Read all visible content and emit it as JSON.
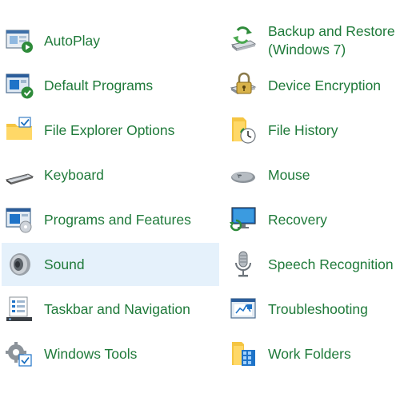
{
  "control_panel": {
    "left_column": [
      {
        "label": "AutoPlay",
        "icon": "autoplay-icon"
      },
      {
        "label": "Default Programs",
        "icon": "default-programs-icon"
      },
      {
        "label": "File Explorer Options",
        "icon": "folder-options-icon"
      },
      {
        "label": "Keyboard",
        "icon": "keyboard-icon"
      },
      {
        "label": "Programs and Features",
        "icon": "programs-features-icon"
      },
      {
        "label": "Sound",
        "icon": "speaker-icon",
        "selected": true
      },
      {
        "label": "Taskbar and Navigation",
        "icon": "taskbar-icon"
      },
      {
        "label": "Windows Tools",
        "icon": "windows-tools-icon"
      }
    ],
    "right_column": [
      {
        "label": "Backup and Restore (Windows 7)",
        "icon": "backup-restore-icon"
      },
      {
        "label": "Device Encryption",
        "icon": "device-encryption-icon"
      },
      {
        "label": "File History",
        "icon": "file-history-icon"
      },
      {
        "label": "Mouse",
        "icon": "mouse-icon"
      },
      {
        "label": "Recovery",
        "icon": "recovery-icon"
      },
      {
        "label": "Speech Recognition",
        "icon": "microphone-icon"
      },
      {
        "label": "Troubleshooting",
        "icon": "troubleshooting-icon"
      },
      {
        "label": "Work Folders",
        "icon": "work-folders-icon"
      }
    ],
    "colors": {
      "link_text": "#1f7a3a",
      "selected_background": "#e5f1fb"
    }
  }
}
